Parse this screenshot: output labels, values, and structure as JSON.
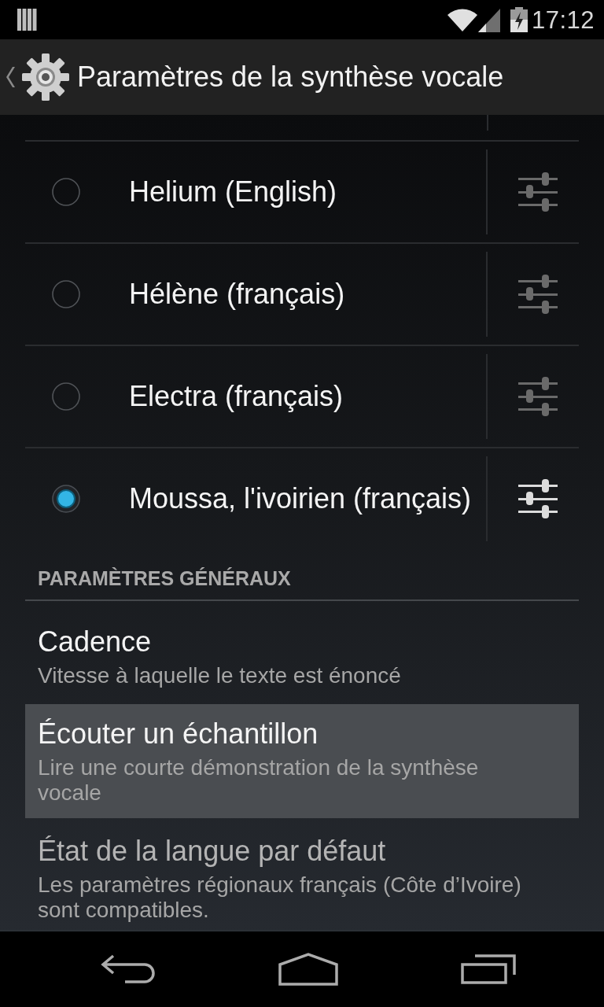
{
  "status_bar": {
    "time": "17:12"
  },
  "action_bar": {
    "title": "Paramètres de la synthèse vocale"
  },
  "engines": [
    {
      "name": "Helium (English)",
      "selected": false
    },
    {
      "name": "Hélène (français)",
      "selected": false
    },
    {
      "name": "Electra (français)",
      "selected": false
    },
    {
      "name": "Moussa, l'ivoirien (français)",
      "selected": true
    }
  ],
  "section_header": "PARAMÈTRES GÉNÉRAUX",
  "preferences": [
    {
      "title": "Cadence",
      "summary": "Vitesse à laquelle le texte est énoncé",
      "pressed": false,
      "disabled": false
    },
    {
      "title": "Écouter un échantillon",
      "summary": "Lire une courte démonstration de la synthèse vocale",
      "pressed": true,
      "disabled": false
    },
    {
      "title": "État de la langue par défaut",
      "summary": "Les paramètres régionaux français (Côte d’Ivoire) sont compatibles.",
      "pressed": false,
      "disabled": true
    }
  ]
}
